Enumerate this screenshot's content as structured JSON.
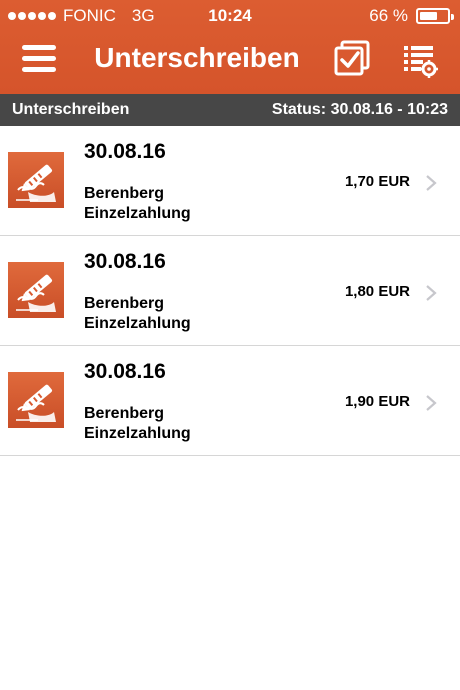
{
  "status_bar": {
    "carrier": "FONIC",
    "network": "3G",
    "time": "10:24",
    "battery": "66 %",
    "battery_level": 0.66
  },
  "nav": {
    "title": "Unterschreiben",
    "menu_icon": "hamburger-menu-icon",
    "check_icon": "checkbox-icon",
    "list_settings_icon": "list-settings-icon"
  },
  "subheader": {
    "title": "Unterschreiben",
    "status": "Status: 30.08.16 - 10:23"
  },
  "colors": {
    "brand": "#d9592f",
    "subheader": "#474747"
  },
  "items": [
    {
      "date": "30.08.16",
      "line1": "Berenberg",
      "line2": "Einzelzahlung",
      "amount": "1,70 EUR",
      "icon": "signature-pen-icon"
    },
    {
      "date": "30.08.16",
      "line1": "Berenberg",
      "line2": "Einzelzahlung",
      "amount": "1,80 EUR",
      "icon": "signature-pen-icon"
    },
    {
      "date": "30.08.16",
      "line1": "Berenberg",
      "line2": "Einzelzahlung",
      "amount": "1,90 EUR",
      "icon": "signature-pen-icon"
    }
  ]
}
